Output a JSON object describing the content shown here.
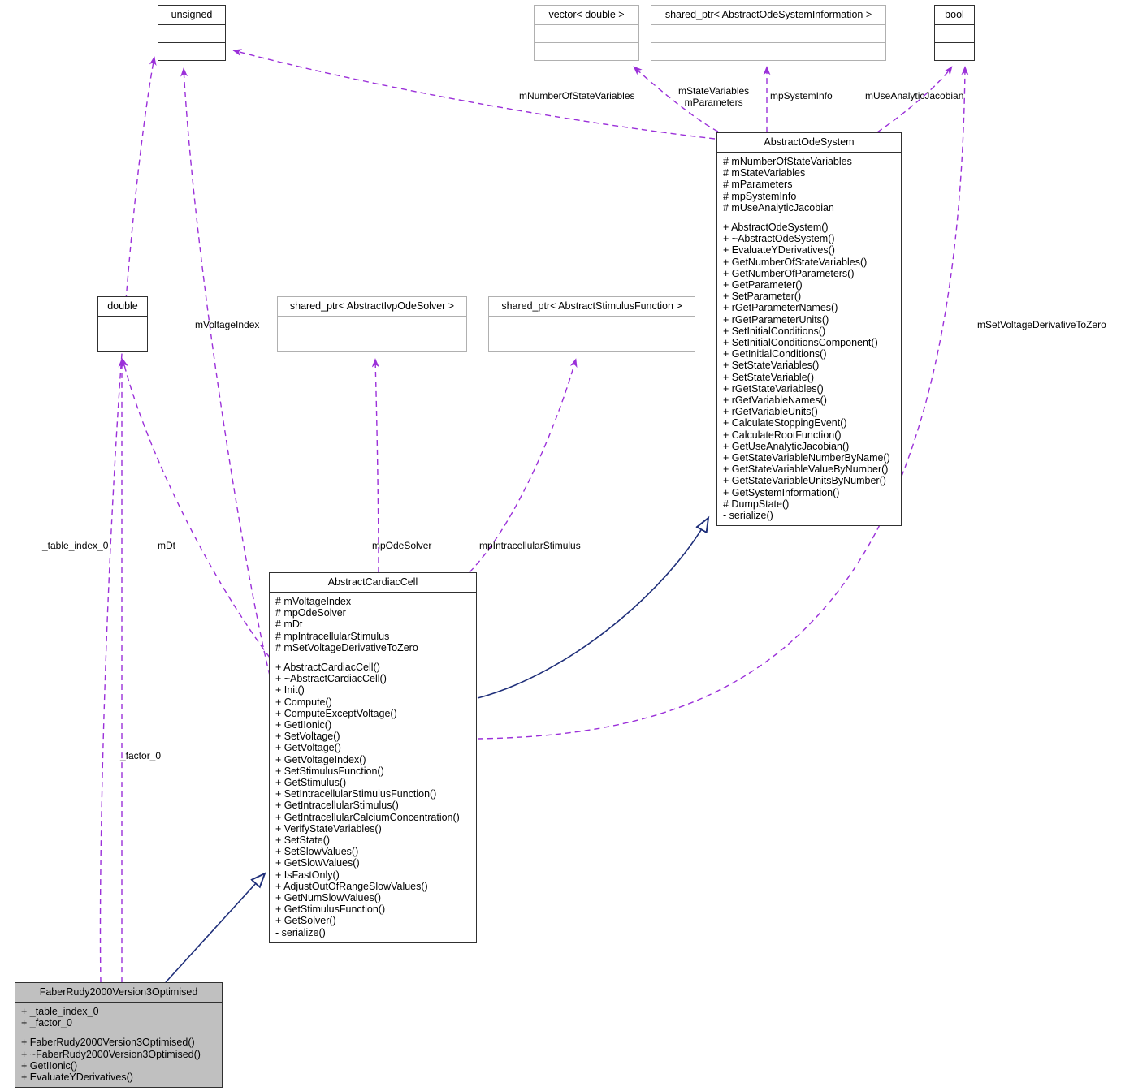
{
  "diagram": {
    "type": "uml-class-diagram",
    "accent_association": "#9b30d9",
    "accent_inheritance": "#1f2f7a",
    "highlight_fill": "#c0c0c0"
  },
  "classes": {
    "unsigned": {
      "name": "unsigned",
      "attributes": [],
      "methods": []
    },
    "vector_double": {
      "name": "vector< double >",
      "attributes": [],
      "methods": []
    },
    "shared_ptr_info": {
      "name": "shared_ptr< AbstractOdeSystemInformation >",
      "attributes": [],
      "methods": []
    },
    "bool": {
      "name": "bool",
      "attributes": [],
      "methods": []
    },
    "double": {
      "name": "double",
      "attributes": [],
      "methods": []
    },
    "shared_ptr_solver": {
      "name": "shared_ptr< AbstractIvpOdeSolver >",
      "attributes": [],
      "methods": []
    },
    "shared_ptr_stimulus": {
      "name": "shared_ptr< AbstractStimulusFunction >",
      "attributes": [],
      "methods": []
    },
    "abstract_ode_system": {
      "name": "AbstractOdeSystem",
      "attributes": [
        "# mNumberOfStateVariables",
        "# mStateVariables",
        "# mParameters",
        "# mpSystemInfo",
        "# mUseAnalyticJacobian"
      ],
      "methods": [
        "+ AbstractOdeSystem()",
        "+ ~AbstractOdeSystem()",
        "+ EvaluateYDerivatives()",
        "+ GetNumberOfStateVariables()",
        "+ GetNumberOfParameters()",
        "+ GetParameter()",
        "+ SetParameter()",
        "+ rGetParameterNames()",
        "+ rGetParameterUnits()",
        "+ SetInitialConditions()",
        "+ SetInitialConditionsComponent()",
        "+ GetInitialConditions()",
        "+ SetStateVariables()",
        "+ SetStateVariable()",
        "+ rGetStateVariables()",
        "+ rGetVariableNames()",
        "+ rGetVariableUnits()",
        "+ CalculateStoppingEvent()",
        "+ CalculateRootFunction()",
        "+ GetUseAnalyticJacobian()",
        "+ GetStateVariableNumberByName()",
        "+ GetStateVariableValueByNumber()",
        "+ GetStateVariableUnitsByNumber()",
        "+ GetSystemInformation()",
        "# DumpState()",
        "- serialize()"
      ]
    },
    "abstract_cardiac_cell": {
      "name": "AbstractCardiacCell",
      "attributes": [
        "# mVoltageIndex",
        "# mpOdeSolver",
        "# mDt",
        "# mpIntracellularStimulus",
        "# mSetVoltageDerivativeToZero"
      ],
      "methods": [
        "+ AbstractCardiacCell()",
        "+ ~AbstractCardiacCell()",
        "+ Init()",
        "+ Compute()",
        "+ ComputeExceptVoltage()",
        "+ GetIIonic()",
        "+ SetVoltage()",
        "+ GetVoltage()",
        "+ GetVoltageIndex()",
        "+ SetStimulusFunction()",
        "+ GetStimulus()",
        "+ SetIntracellularStimulusFunction()",
        "+ GetIntracellularStimulus()",
        "+ GetIntracellularCalciumConcentration()",
        "+ VerifyStateVariables()",
        "+ SetState()",
        "+ SetSlowValues()",
        "+ GetSlowValues()",
        "+ IsFastOnly()",
        "+ AdjustOutOfRangeSlowValues()",
        "+ GetNumSlowValues()",
        "+ GetStimulusFunction()",
        "+ GetSolver()",
        "- serialize()"
      ]
    },
    "faber_rudy": {
      "name": "FaberRudy2000Version3Optimised",
      "attributes": [
        "+ _table_index_0",
        "+ _factor_0"
      ],
      "methods": [
        "+ FaberRudy2000Version3Optimised()",
        "+ ~FaberRudy2000Version3Optimised()",
        "+ GetIIonic()",
        "+ EvaluateYDerivatives()"
      ]
    }
  },
  "edge_labels": {
    "m_number_of_state_variables": "mNumberOfStateVariables",
    "m_state_variables": "mStateVariables",
    "m_parameters": "mParameters",
    "mp_system_info": "mpSystemInfo",
    "m_use_analytic_jacobian": "mUseAnalyticJacobian",
    "m_set_voltage_derivative_to_zero": "mSetVoltageDerivativeToZero",
    "m_voltage_index": "mVoltageIndex",
    "mp_ode_solver": "mpOdeSolver",
    "mp_intracellular_stimulus": "mpIntracellularStimulus",
    "table_index_0": "_table_index_0",
    "m_dt": "mDt",
    "factor_0": "_factor_0"
  }
}
